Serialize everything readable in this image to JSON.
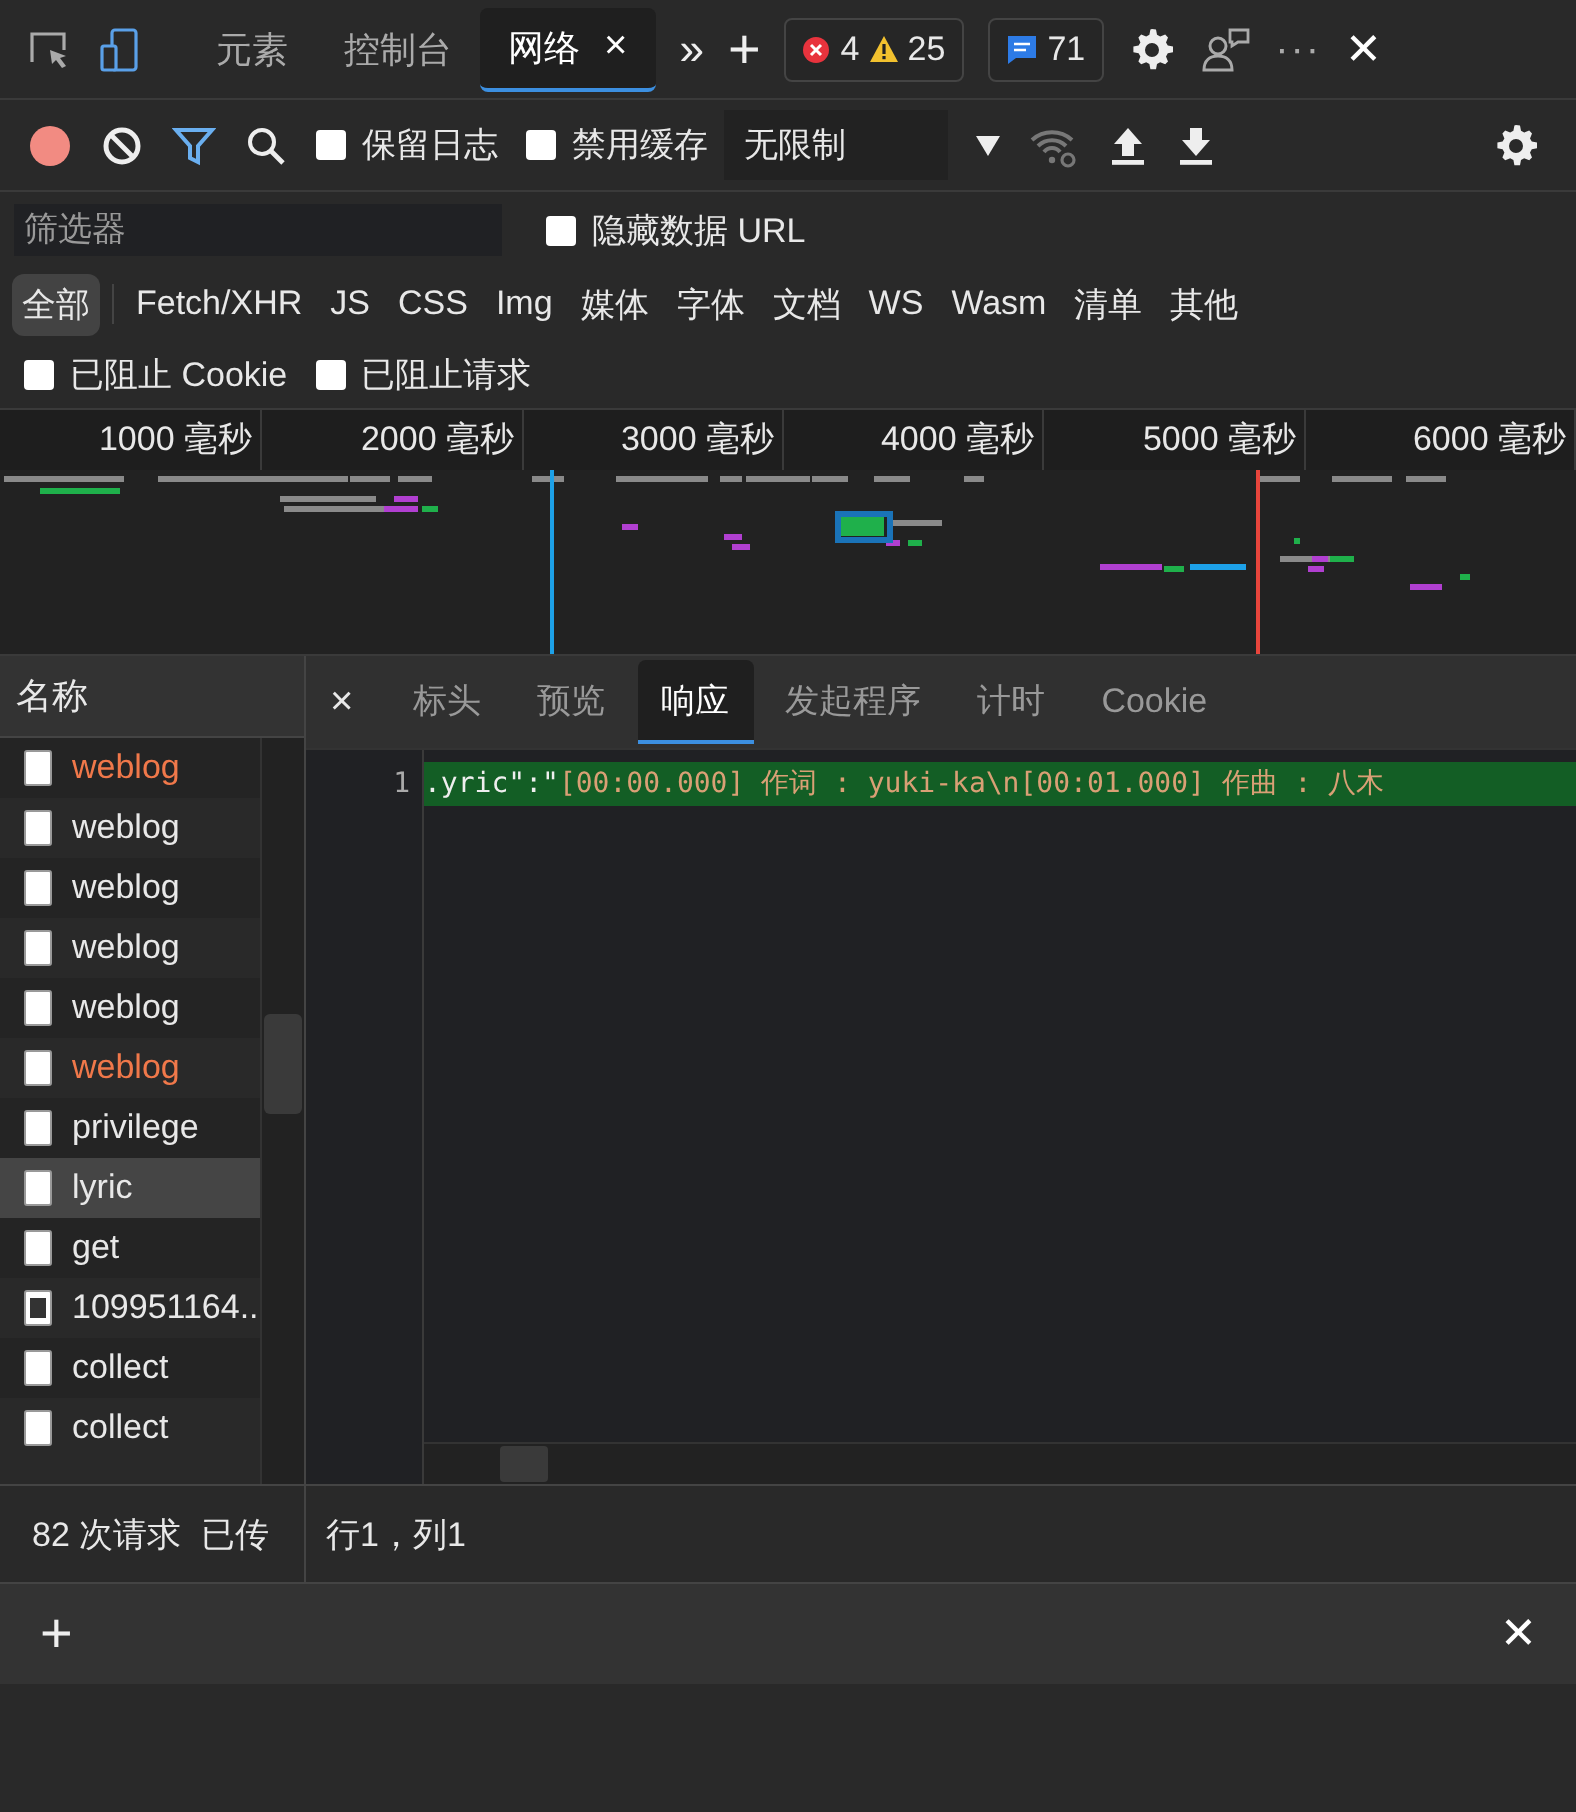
{
  "top_bar": {
    "tabs": [
      {
        "label": "元素",
        "selected": false,
        "closable": false
      },
      {
        "label": "控制台",
        "selected": false,
        "closable": false
      },
      {
        "label": "网络",
        "selected": true,
        "closable": true
      }
    ],
    "tab_close": "×",
    "more_tabs": "»",
    "add_tab": "+",
    "errors": "4",
    "warnings": "25",
    "messages": "71",
    "more_menu": "···",
    "close": "✕"
  },
  "toolbar": {
    "checkboxes": [
      {
        "label": "保留日志",
        "checked": false
      },
      {
        "label": "禁用缓存",
        "checked": false
      }
    ],
    "throttling": "无限制"
  },
  "filter": {
    "placeholder": "筛选器",
    "hide_data_urls": {
      "label": "隐藏数据 URL",
      "checked": false
    }
  },
  "type_filters": [
    {
      "label": "全部",
      "selected": true
    },
    {
      "label": "Fetch/XHR",
      "selected": false
    },
    {
      "label": "JS",
      "selected": false
    },
    {
      "label": "CSS",
      "selected": false
    },
    {
      "label": "Img",
      "selected": false
    },
    {
      "label": "媒体",
      "selected": false
    },
    {
      "label": "字体",
      "selected": false
    },
    {
      "label": "文档",
      "selected": false
    },
    {
      "label": "WS",
      "selected": false
    },
    {
      "label": "Wasm",
      "selected": false
    },
    {
      "label": "清单",
      "selected": false
    },
    {
      "label": "其他",
      "selected": false
    }
  ],
  "blocked_filters": [
    {
      "label": "已阻止 Cookie",
      "checked": false
    },
    {
      "label": "已阻止请求",
      "checked": false
    }
  ],
  "overview": {
    "ticks": [
      "1000 毫秒",
      "2000 毫秒",
      "3000 毫秒",
      "4000 毫秒",
      "5000 毫秒",
      "6000 毫秒"
    ]
  },
  "requests": {
    "column": "名称",
    "rows": [
      {
        "name": "weblog",
        "kind": "file",
        "failed": true,
        "selected": false
      },
      {
        "name": "weblog",
        "kind": "file",
        "failed": false,
        "selected": false
      },
      {
        "name": "weblog",
        "kind": "file",
        "failed": false,
        "selected": false
      },
      {
        "name": "weblog",
        "kind": "file",
        "failed": false,
        "selected": false
      },
      {
        "name": "weblog",
        "kind": "file",
        "failed": false,
        "selected": false
      },
      {
        "name": "weblog",
        "kind": "file",
        "failed": true,
        "selected": false
      },
      {
        "name": "privilege",
        "kind": "file",
        "failed": false,
        "selected": false
      },
      {
        "name": "lyric",
        "kind": "file",
        "failed": false,
        "selected": true
      },
      {
        "name": "get",
        "kind": "file",
        "failed": false,
        "selected": false
      },
      {
        "name": "109951164..",
        "kind": "image",
        "failed": false,
        "selected": false
      },
      {
        "name": "collect",
        "kind": "file",
        "failed": false,
        "selected": false
      },
      {
        "name": "collect",
        "kind": "file",
        "failed": false,
        "selected": false
      }
    ],
    "summary": [
      "82 次请求",
      "已传"
    ]
  },
  "detail": {
    "close": "×",
    "tabs": [
      {
        "label": "标头",
        "selected": false
      },
      {
        "label": "预览",
        "selected": false
      },
      {
        "label": "响应",
        "selected": true
      },
      {
        "label": "发起程序",
        "selected": false
      },
      {
        "label": "计时",
        "selected": false
      },
      {
        "label": "Cookie",
        "selected": false
      }
    ],
    "lines": [
      {
        "number": "1",
        "key": ".yric\":\"",
        "value": "[00:00.000] 作词 : yuki-ka\\n[00:01.000] 作曲 : 八木",
        "highlighted": true
      }
    ],
    "cursor": "行1，列1"
  },
  "drawer": {
    "add": "+",
    "close": "✕"
  }
}
